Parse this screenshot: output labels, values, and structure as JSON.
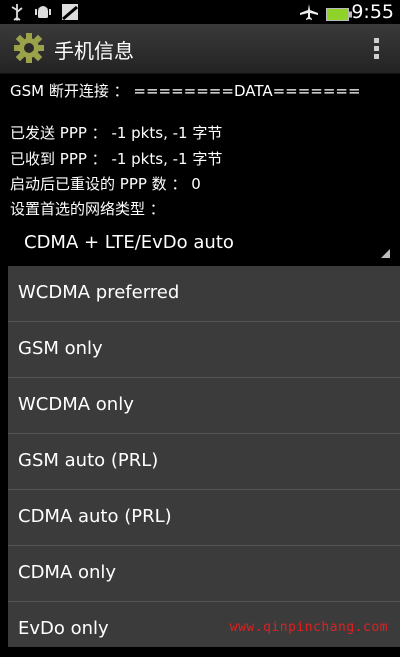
{
  "status_bar": {
    "time": "9:55",
    "icons": [
      "usb-icon",
      "android-debug-icon",
      "sd-card-icon",
      "airplane-mode-icon",
      "battery-icon"
    ]
  },
  "title_bar": {
    "title": "手机信息",
    "icon": "settings-gear-icon",
    "menu_icon": "overflow-menu-icon"
  },
  "info": {
    "gsm_disconnect": "GSM 断开连接 ： ========DATA=======",
    "ppp_sent": "已发送 PPP ： -1 pkts, -1 字节",
    "ppp_received": "已收到 PPP ： -1 pkts, -1 字节",
    "ppp_resets": "启动后已重设的 PPP 数 ： 0",
    "preferred_network_label": "设置首选的网络类型 ："
  },
  "spinner": {
    "selected": "CDMA + LTE/EvDo auto"
  },
  "options": [
    "WCDMA preferred",
    "GSM only",
    "WCDMA only",
    "GSM auto (PRL)",
    "CDMA auto (PRL)",
    "CDMA only",
    "EvDo only"
  ],
  "watermark": "www.qinpinchang.com",
  "colors": {
    "background": "#000000",
    "title_bar": "#2d2d2d",
    "dropdown": "#3b3b3b",
    "divider": "#555555",
    "battery": "#8ed22a",
    "watermark": "#e02020"
  }
}
